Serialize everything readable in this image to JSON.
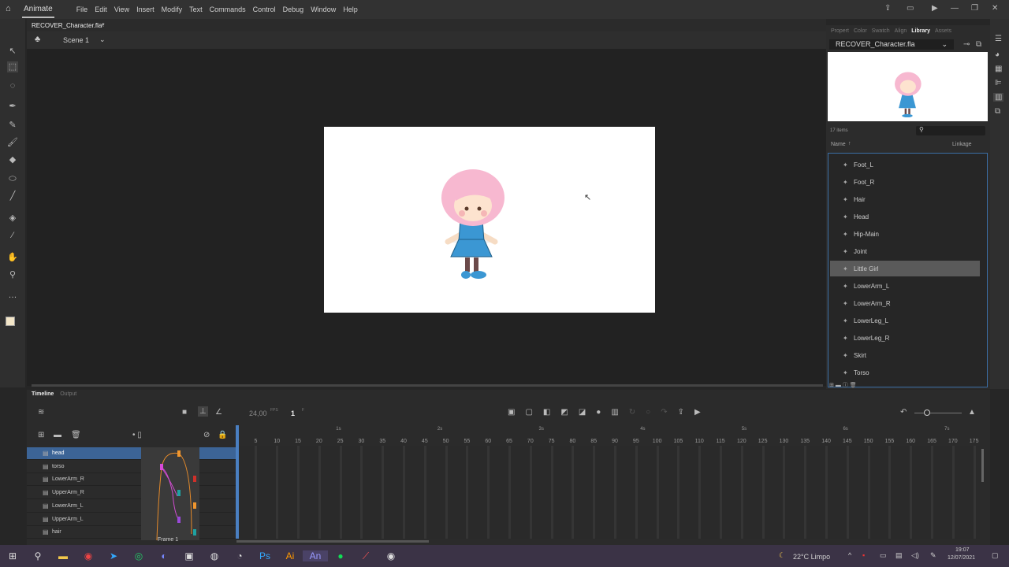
{
  "menubar": {
    "app": "Animate",
    "items": [
      "File",
      "Edit",
      "View",
      "Insert",
      "Modify",
      "Text",
      "Commands",
      "Control",
      "Debug",
      "Window",
      "Help"
    ]
  },
  "document_tab": {
    "label": "RECOVER_Character.fla*",
    "close": "×"
  },
  "scene": {
    "label": "Scene 1"
  },
  "panel": {
    "tabs": [
      "Propert",
      "Color",
      "Swatch",
      "Align",
      "Library",
      "Assets"
    ],
    "active_tab": "Library",
    "file": "RECOVER_Character.fla",
    "count": "17 items",
    "col_name": "Name",
    "col_linkage": "Linkage",
    "items": [
      {
        "name": "Foot_L"
      },
      {
        "name": "Foot_R"
      },
      {
        "name": "Hair"
      },
      {
        "name": "Head"
      },
      {
        "name": "Hip-Main"
      },
      {
        "name": "Joint"
      },
      {
        "name": "Little Girl",
        "selected": true
      },
      {
        "name": "LowerArm_L"
      },
      {
        "name": "LowerArm_R"
      },
      {
        "name": "LowerLeg_L"
      },
      {
        "name": "LowerLeg_R"
      },
      {
        "name": "Skirt"
      },
      {
        "name": "Torso"
      }
    ]
  },
  "timeline": {
    "tabs": [
      "Timeline",
      "Output"
    ],
    "fps": "24,00",
    "fps_unit": "FPS",
    "frame": "1",
    "frame_unit": "F",
    "frame_label": "Frame",
    "frame_value": "1",
    "layers": [
      {
        "name": "head",
        "selected": true
      },
      {
        "name": "torso"
      },
      {
        "name": "LowerArm_R"
      },
      {
        "name": "UpperArm_R"
      },
      {
        "name": "LowerArm_L"
      },
      {
        "name": "UpperArm_L"
      },
      {
        "name": "hair"
      }
    ],
    "ruler": [
      "5",
      "10",
      "15",
      "20",
      "25",
      "30",
      "35",
      "40",
      "45",
      "50",
      "55",
      "60",
      "65",
      "70",
      "75",
      "80",
      "85",
      "90",
      "95",
      "100",
      "105",
      "110",
      "115",
      "120",
      "125",
      "130",
      "135",
      "140",
      "145",
      "150",
      "155",
      "160",
      "165",
      "170",
      "175"
    ],
    "seconds": [
      "1s",
      "2s",
      "3s",
      "4s",
      "5s",
      "6s",
      "7s"
    ]
  },
  "taskbar": {
    "weather": "22°C  Limpo",
    "time": "19:07",
    "date": "12/07/2021"
  },
  "colors": {
    "accent": "#3c6496",
    "stage": "#ffffff",
    "hair": "#f7b8d0",
    "dress": "#3b97d3"
  }
}
